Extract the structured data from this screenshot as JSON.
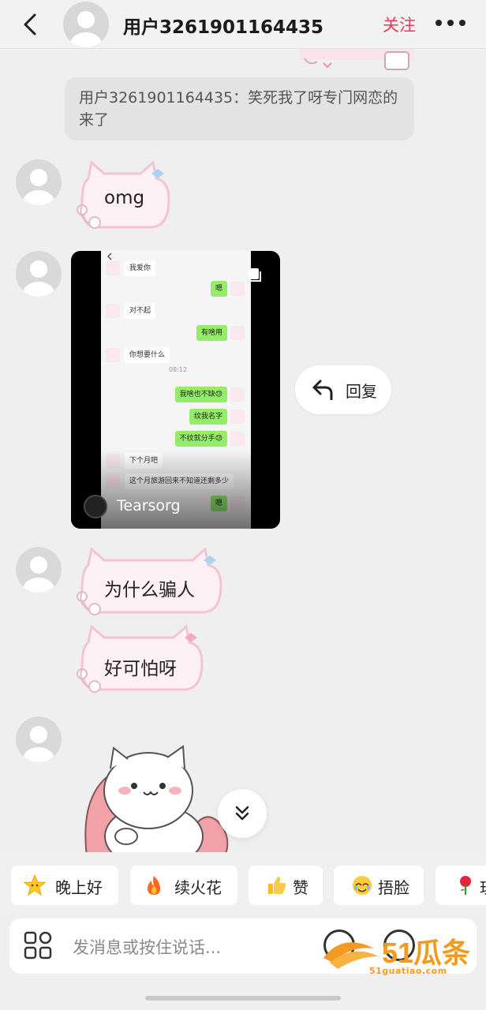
{
  "header": {
    "username": "用户3261901164435",
    "follow_label": "关注"
  },
  "quote": {
    "text": "用户3261901164435：笑死我了呀专门网恋的来了"
  },
  "messages": [
    {
      "text": "omg"
    },
    {
      "text": "为什么骗人"
    },
    {
      "text": "好可怕呀"
    }
  ],
  "video": {
    "author": "Tearsorg",
    "chat": [
      {
        "side": "left",
        "text": "我爱你"
      },
      {
        "side": "right",
        "text": "嗯"
      },
      {
        "side": "left",
        "text": "对不起"
      },
      {
        "side": "right",
        "text": "有啥用"
      },
      {
        "side": "left",
        "text": "你想要什么"
      },
      {
        "side": "time",
        "text": "08:12"
      },
      {
        "side": "right",
        "text": "我啥也不缺😓"
      },
      {
        "side": "right",
        "text": "纹我名字"
      },
      {
        "side": "right",
        "text": "不纹就分手😓"
      },
      {
        "side": "left",
        "text": "下个月吧"
      },
      {
        "side": "left",
        "text": "这个月旅游回来不知道还剩多少"
      },
      {
        "side": "right",
        "text": "嗯"
      }
    ]
  },
  "reply_label": "回复",
  "quick_replies": [
    {
      "icon": "star-face-icon",
      "label": "晚上好"
    },
    {
      "icon": "fire-icon",
      "label": "续火花"
    },
    {
      "icon": "thumbs-up-icon",
      "label": "赞"
    },
    {
      "icon": "face-palm-icon",
      "label": "捂脸"
    },
    {
      "icon": "rose-icon",
      "label": "玫"
    }
  ],
  "input": {
    "placeholder": "发消息或按住说话..."
  },
  "watermark": {
    "brand": "51瓜条",
    "url": "51guatiao.com"
  },
  "colors": {
    "accent": "#f23457",
    "bubble_fill": "#fdf1f6",
    "bubble_stroke": "#f4c4d4",
    "wechat_green": "#95ec69",
    "watermark": "#f39a1f"
  }
}
